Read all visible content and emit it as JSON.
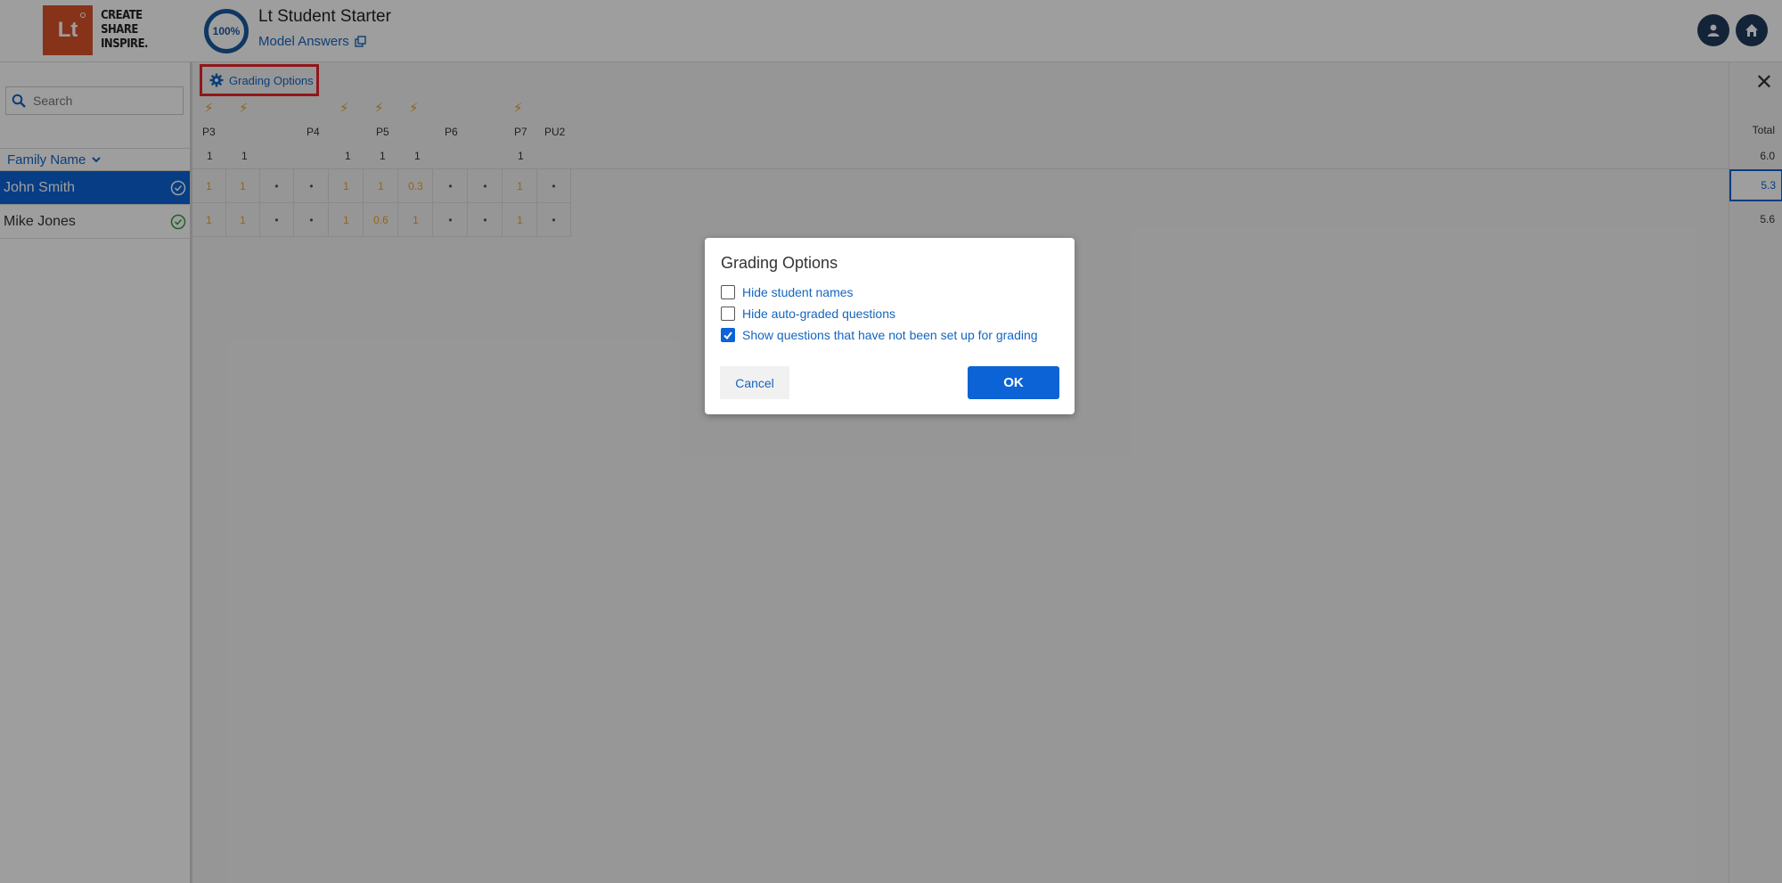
{
  "header": {
    "logo_mark": "Lt",
    "logo_lines": [
      "CREATE",
      "SHARE",
      "INSPIRE."
    ],
    "progress": "100%",
    "title": "Lt Student Starter",
    "model_answers": "Model Answers"
  },
  "sidebar": {
    "search_placeholder": "Search",
    "sort_label": "Family Name",
    "students": [
      {
        "name": "John Smith",
        "selected": true
      },
      {
        "name": "Mike Jones",
        "selected": false
      }
    ]
  },
  "grid": {
    "grading_options_label": "Grading Options",
    "columns": [
      "P3",
      "P4",
      "P5",
      "P6",
      "P7",
      "PU2"
    ],
    "points_row": [
      "1",
      "1",
      "1",
      "1",
      "1",
      "1"
    ],
    "rows": [
      [
        "1",
        "1",
        "•",
        "•",
        "1",
        "1",
        "0.3",
        "•",
        "•",
        "1",
        "•"
      ],
      [
        "1",
        "1",
        "•",
        "•",
        "1",
        "0.6",
        "1",
        "•",
        "•",
        "1",
        "•"
      ]
    ],
    "total_label": "Total",
    "totals": [
      "6.0",
      "5.3",
      "5.6"
    ]
  },
  "modal": {
    "title": "Grading Options",
    "options": [
      {
        "label": "Hide student names",
        "checked": false
      },
      {
        "label": "Hide auto-graded questions",
        "checked": false
      },
      {
        "label": "Show questions that have not been set up for grading",
        "checked": true
      }
    ],
    "cancel": "Cancel",
    "ok": "OK"
  },
  "colors": {
    "primary": "#0b63d6",
    "link": "#1565c0",
    "score": "#f0a020",
    "highlight_border": "#e8252a",
    "logo": "#d9532a"
  }
}
